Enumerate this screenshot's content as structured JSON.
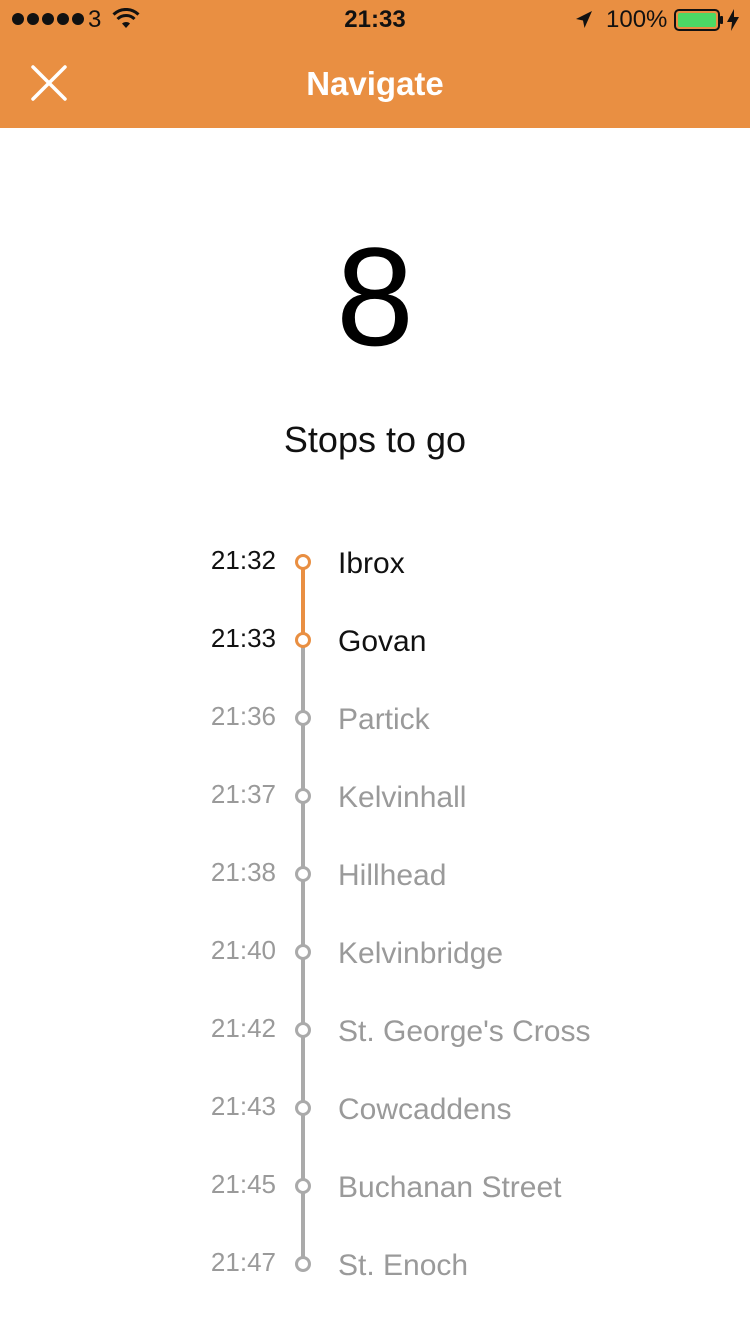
{
  "status_bar": {
    "carrier": "3",
    "time": "21:33",
    "battery": "100%"
  },
  "nav": {
    "title": "Navigate",
    "close_icon": "close-icon"
  },
  "stops_remaining": {
    "count": "8",
    "label": "Stops to go"
  },
  "stops": [
    {
      "time": "21:32",
      "name": "Ibrox",
      "state": "passed"
    },
    {
      "time": "21:33",
      "name": "Govan",
      "state": "passed"
    },
    {
      "time": "21:36",
      "name": "Partick",
      "state": "upcoming"
    },
    {
      "time": "21:37",
      "name": "Kelvinhall",
      "state": "upcoming"
    },
    {
      "time": "21:38",
      "name": "Hillhead",
      "state": "upcoming"
    },
    {
      "time": "21:40",
      "name": "Kelvinbridge",
      "state": "upcoming"
    },
    {
      "time": "21:42",
      "name": "St. George's Cross",
      "state": "upcoming"
    },
    {
      "time": "21:43",
      "name": "Cowcaddens",
      "state": "upcoming"
    },
    {
      "time": "21:45",
      "name": "Buchanan Street",
      "state": "upcoming"
    },
    {
      "time": "21:47",
      "name": "St. Enoch",
      "state": "upcoming"
    }
  ],
  "colors": {
    "accent": "#E98F42",
    "upcoming": "#9a9a9a",
    "line_upcoming": "#aaaaaa"
  }
}
